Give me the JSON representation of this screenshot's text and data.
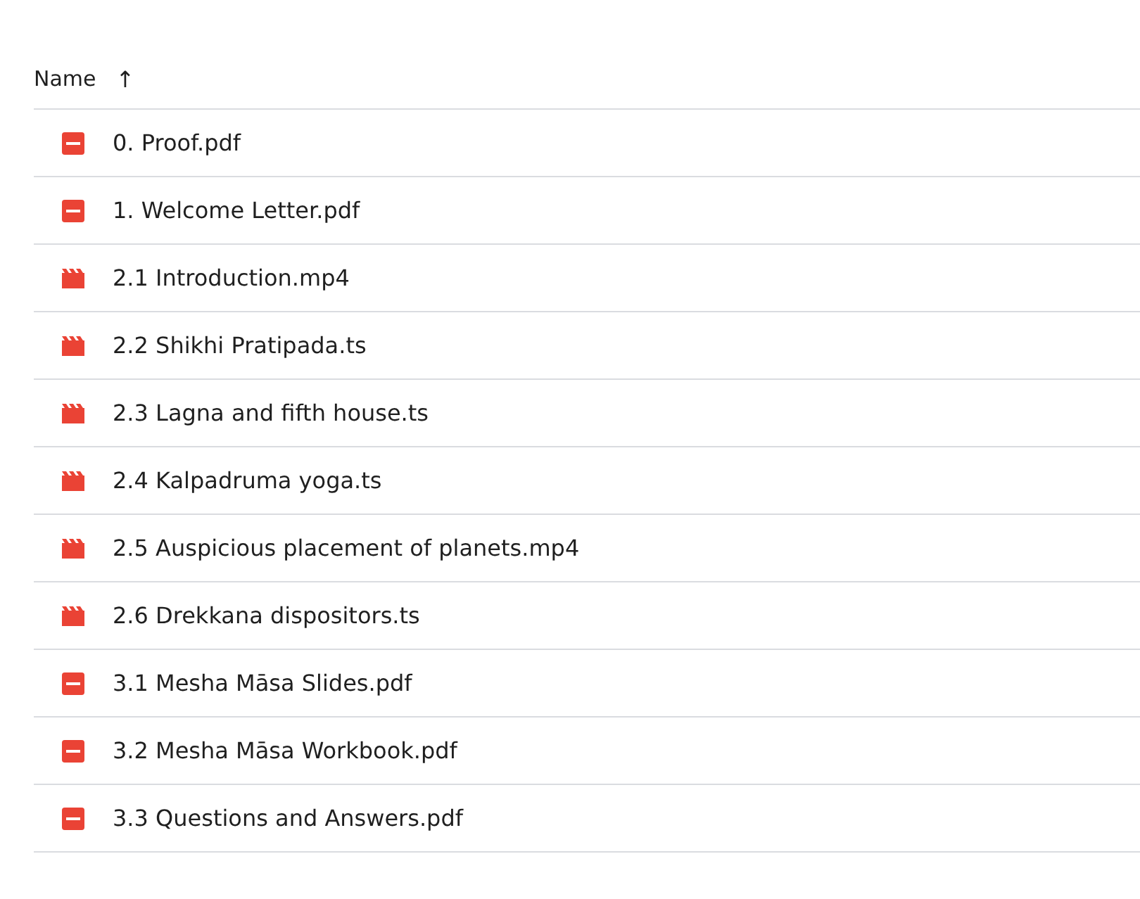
{
  "header": {
    "label": "Name",
    "sort_arrow": "↑"
  },
  "files": [
    {
      "name": "0. Proof.pdf",
      "kind": "pdf"
    },
    {
      "name": "1. Welcome Letter.pdf",
      "kind": "pdf"
    },
    {
      "name": "2.1 Introduction.mp4",
      "kind": "video"
    },
    {
      "name": "2.2 Shikhi Pratipada.ts",
      "kind": "video"
    },
    {
      "name": "2.3 Lagna and fifth house.ts",
      "kind": "video"
    },
    {
      "name": "2.4 Kalpadruma yoga.ts",
      "kind": "video"
    },
    {
      "name": "2.5 Auspicious placement of planets.mp4",
      "kind": "video"
    },
    {
      "name": "2.6 Drekkana dispositors.ts",
      "kind": "video"
    },
    {
      "name": "3.1 Mesha Māsa Slides.pdf",
      "kind": "pdf"
    },
    {
      "name": "3.2 Mesha Māsa Workbook.pdf",
      "kind": "pdf"
    },
    {
      "name": "3.3 Questions and Answers.pdf",
      "kind": "pdf"
    }
  ]
}
